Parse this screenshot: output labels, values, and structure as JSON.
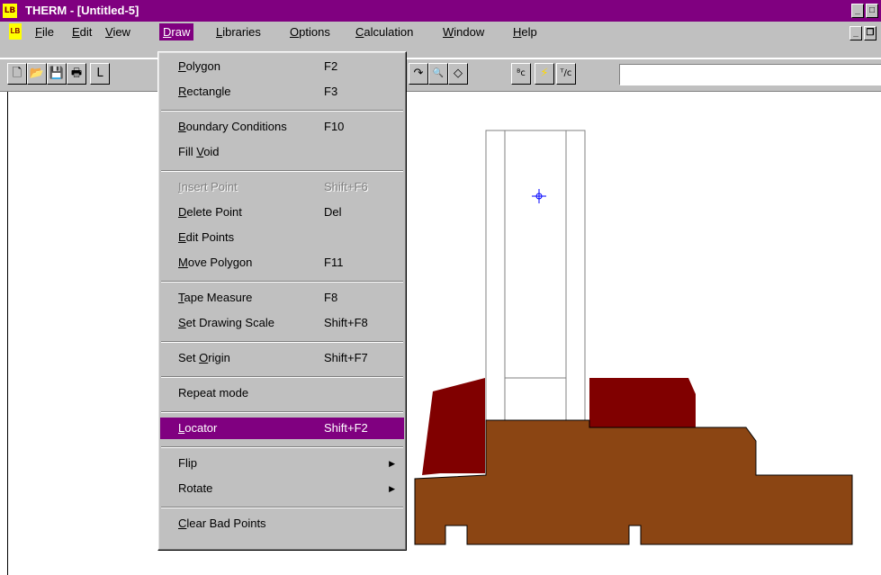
{
  "window": {
    "app_icon": "therm-app-icon",
    "title": "THERM - [Untitled-5]",
    "controls": [
      "minimize-icon",
      "maximize-icon"
    ]
  },
  "menubar": {
    "doc_icon": "therm-document-icon",
    "items": [
      "File",
      "Edit",
      "View",
      "Draw",
      "Libraries",
      "Options",
      "Calculation",
      "Window",
      "Help"
    ],
    "active": "Draw"
  },
  "toolbar": {
    "buttons": [
      {
        "name": "new-icon",
        "glyph": "🗋"
      },
      {
        "name": "open-icon",
        "glyph": "📂"
      },
      {
        "name": "save-icon",
        "glyph": "💾"
      },
      {
        "name": "print-icon",
        "glyph": "🖶"
      },
      {
        "name": "partial-icon",
        "glyph": "L"
      },
      {
        "name": "arc-icon",
        "glyph": "↷"
      },
      {
        "name": "zoom-icon",
        "glyph": "🔍"
      },
      {
        "name": "rotate-icon",
        "glyph": "◇"
      },
      {
        "name": "bc-icon",
        "glyph": "ᴮc"
      },
      {
        "name": "calculation-lightning-icon",
        "glyph": "⚡"
      },
      {
        "name": "tc-icon",
        "glyph": "ᵀ/c"
      }
    ],
    "combo_value": ""
  },
  "draw_menu": {
    "items": [
      {
        "label": "Polygon",
        "ul": "P",
        "shortcut": "F2"
      },
      {
        "label": "Rectangle",
        "ul": "R",
        "shortcut": "F3"
      },
      {
        "sep": true
      },
      {
        "label": "Boundary Conditions",
        "ul": "B",
        "shortcut": "F10"
      },
      {
        "label": "Fill Void",
        "ul": "V",
        "shortcut": ""
      },
      {
        "sep": true
      },
      {
        "label": "Insert Point",
        "ul": "I",
        "shortcut": "Shift+F6",
        "disabled": true
      },
      {
        "label": "Delete Point",
        "ul": "D",
        "shortcut": "Del"
      },
      {
        "label": "Edit Points",
        "ul": "E",
        "shortcut": ""
      },
      {
        "label": "Move Polygon",
        "ul": "M",
        "shortcut": "F11"
      },
      {
        "sep": true
      },
      {
        "label": "Tape Measure",
        "ul": "T",
        "shortcut": "F8"
      },
      {
        "label": "Set Drawing Scale",
        "ul": "S",
        "shortcut": "Shift+F8"
      },
      {
        "sep": true
      },
      {
        "label": "Set Origin",
        "ul": "O",
        "shortcut": "Shift+F7"
      },
      {
        "sep": true
      },
      {
        "label": "Repeat mode",
        "ul": "",
        "shortcut": ""
      },
      {
        "sep": true
      },
      {
        "label": "Locator",
        "ul": "L",
        "shortcut": "Shift+F2",
        "selected": true
      },
      {
        "sep": true
      },
      {
        "label": "Flip",
        "ul": "",
        "shortcut": "",
        "submenu": true
      },
      {
        "label": "Rotate",
        "ul": "",
        "shortcut": "",
        "submenu": true
      },
      {
        "sep": true
      },
      {
        "label": "Clear Bad Points",
        "ul": "C",
        "shortcut": ""
      }
    ]
  },
  "colors": {
    "titlebar": "#800080",
    "highlight": "#800080",
    "face": "#c0c0c0",
    "dark_red_material": "#800000",
    "brown_material": "#8b4513",
    "locator_marker": "#0000ff"
  }
}
